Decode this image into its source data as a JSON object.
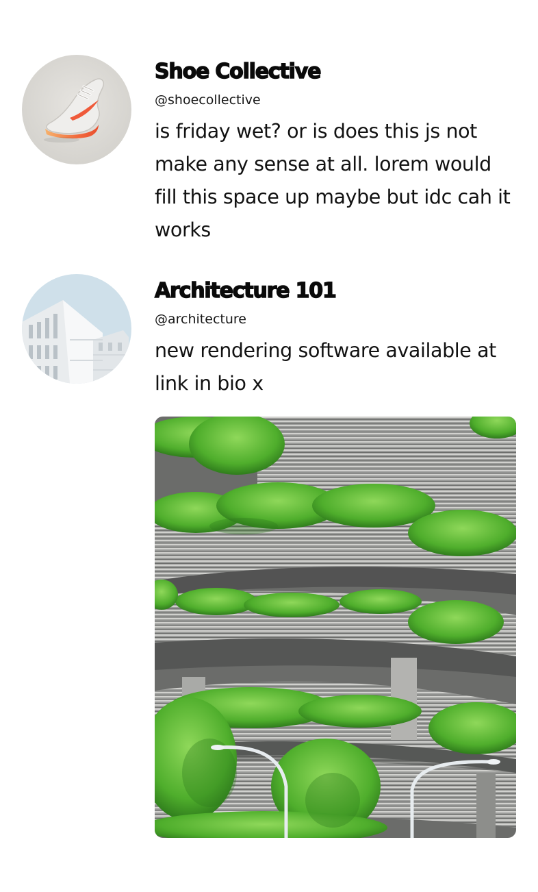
{
  "posts": [
    {
      "display_name": "Shoe Collective",
      "handle": "@shoecollective",
      "text": "is friday wet? or is does this js not make any sense at all. lorem would fill this space up maybe but idc cah it works"
    },
    {
      "display_name": "Architecture 101",
      "handle": "@architecture",
      "text": "new rendering software available at link in bio x"
    }
  ],
  "icons": {
    "post1_avatar": "sneaker-photo",
    "post2_avatar": "building-photo",
    "post2_media": "green-building-photo"
  },
  "colors": {
    "background": "#ffffff",
    "text": "#111111",
    "accent_orange": "#f26a3d",
    "sky": "#cfe0ea",
    "foliage": "#5fbf3a"
  }
}
